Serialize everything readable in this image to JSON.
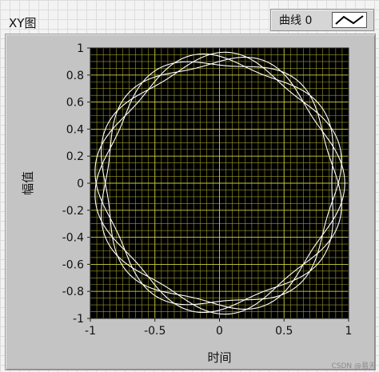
{
  "window": {
    "title": "XY图"
  },
  "legend": {
    "label": "曲线 0",
    "line_color": "#000000"
  },
  "watermark": "CSDN @易天",
  "colors": {
    "plot_background": "#000000",
    "grid": "#9a9a2a",
    "grid_major": "#c8c83a",
    "trace": "#ffffff",
    "panel": "#c4c4c4"
  },
  "chart_data": {
    "type": "line",
    "title": "",
    "xlabel": "时间",
    "ylabel": "幅值",
    "xlim": [
      -1,
      1
    ],
    "ylim": [
      -1,
      1
    ],
    "x_ticks": [
      "-1",
      "-0.5",
      "0",
      "0.5",
      "1"
    ],
    "y_ticks": [
      "1",
      "0.8",
      "0.6",
      "0.4",
      "0.2",
      "0",
      "-0.2",
      "-0.4",
      "-0.6",
      "-0.8",
      "-1"
    ],
    "grid": true,
    "legend_position": "top-right",
    "series": [
      {
        "name": "曲线 0",
        "shape": "ring of circles with sinusoidal radial modulation",
        "base_radius": 0.92,
        "modulation_amplitude": 0.05,
        "lobes": 20,
        "turns": 4
      }
    ]
  }
}
